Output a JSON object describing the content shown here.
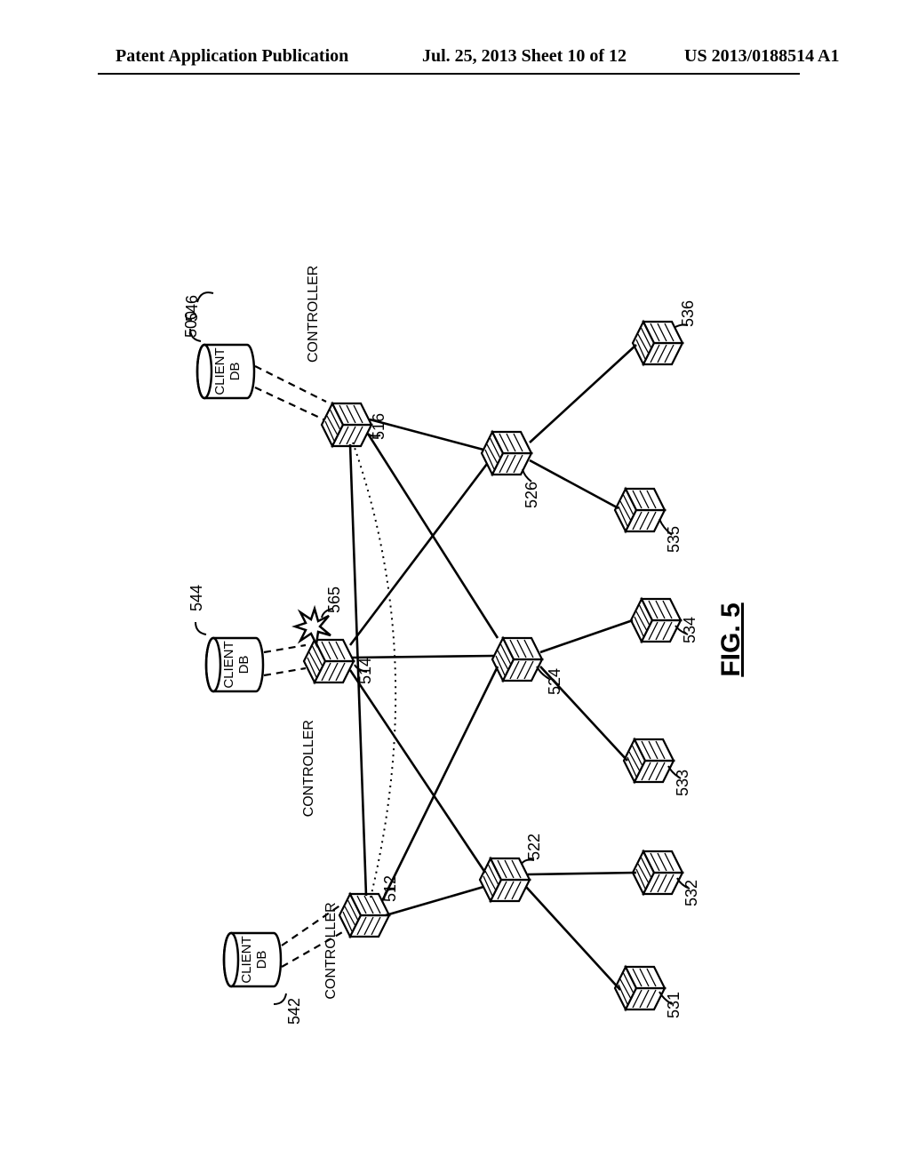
{
  "header": {
    "left": "Patent Application Publication",
    "center": "Jul. 25, 2013  Sheet 10 of 12",
    "right": "US 2013/0188514 A1"
  },
  "figure": {
    "title": "FIG. 5",
    "overall_ref": "500",
    "cylinders": [
      {
        "ref": "542",
        "top": "CLIENT",
        "bottom": "DB"
      },
      {
        "ref": "544",
        "top": "CLIENT",
        "bottom": "DB"
      },
      {
        "ref": "546",
        "top": "CLIENT",
        "bottom": "DB"
      }
    ],
    "controllers": {
      "left": {
        "ref": "512",
        "label": "CONTROLLER"
      },
      "center": {
        "ref": "514",
        "label": "CONTROLLER"
      },
      "right": {
        "ref": "516",
        "label": "CONTROLLER"
      }
    },
    "failure_ref": "565",
    "mid_nodes": [
      {
        "ref": "522"
      },
      {
        "ref": "524"
      },
      {
        "ref": "526"
      }
    ],
    "leaf_nodes": [
      {
        "ref": "531"
      },
      {
        "ref": "532"
      },
      {
        "ref": "533"
      },
      {
        "ref": "534"
      },
      {
        "ref": "535"
      },
      {
        "ref": "536"
      }
    ]
  }
}
